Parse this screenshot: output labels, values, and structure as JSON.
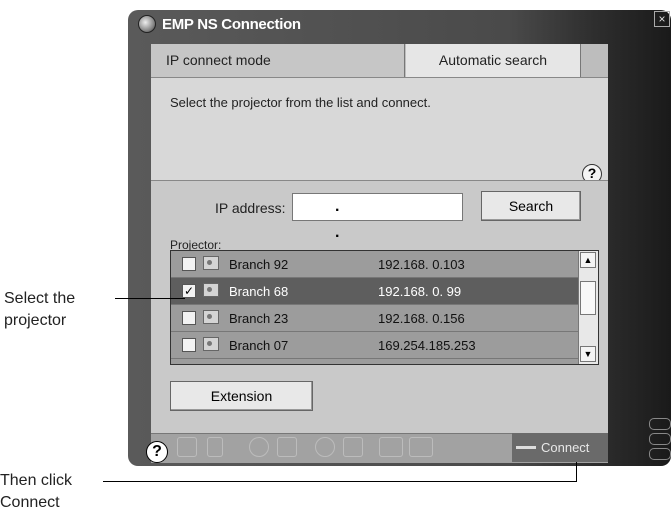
{
  "window": {
    "title": "EMP NS Connection"
  },
  "tabs": {
    "ip_mode": "IP connect mode",
    "auto_search": "Automatic search"
  },
  "instruction": "Select the projector from the list and connect.",
  "help_glyph": "?",
  "ip": {
    "label": "IP address:",
    "value": ". . ."
  },
  "search_button": "Search",
  "projector_label": "Projector:",
  "projectors": [
    {
      "checked": false,
      "name": "Branch 92",
      "ip": "192.168.  0.103",
      "selected": false
    },
    {
      "checked": true,
      "name": "Branch 68",
      "ip": "192.168.  0. 99",
      "selected": true
    },
    {
      "checked": false,
      "name": "Branch 23",
      "ip": "192.168.  0.156",
      "selected": false
    },
    {
      "checked": false,
      "name": "Branch 07",
      "ip": "169.254.185.253",
      "selected": false
    }
  ],
  "extension_button": "Extension",
  "connect_button": "Connect",
  "toolbar_icons": [
    "help-icon",
    "screen-icon",
    "document-icon",
    "pause-icon",
    "no-signal-icon",
    "zoom-icon",
    "undo-icon",
    "video-icon",
    "keyboard-icon",
    "plug-icon"
  ],
  "callouts": {
    "select": [
      "Select the",
      "projector"
    ],
    "connect": [
      "Then click",
      "Connect"
    ]
  },
  "colors": {
    "window_dark": "#4a4a4a",
    "panel": "#d8d8d8",
    "selected_row": "#5e5e5e"
  }
}
